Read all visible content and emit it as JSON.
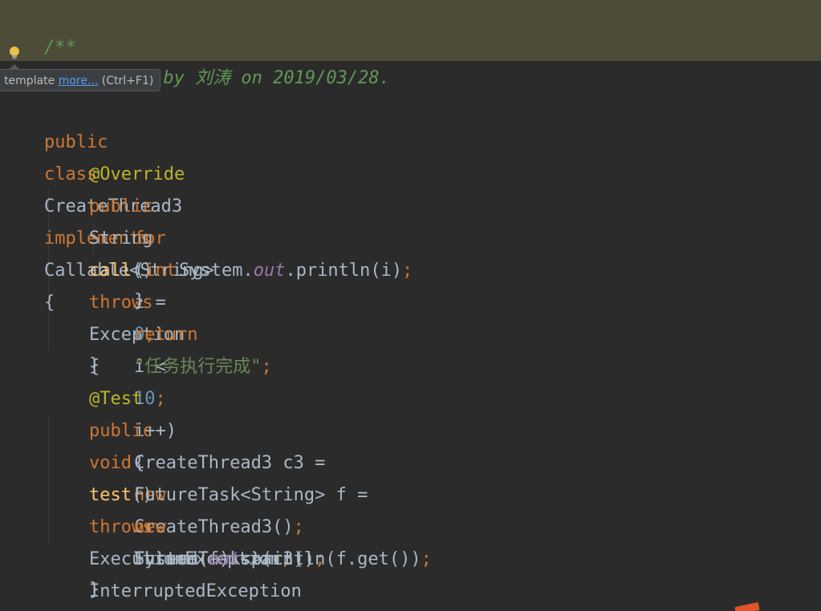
{
  "editor": {
    "colors": {
      "background": "#2b2b2b",
      "doc_band": "#4d4c38",
      "keyword": "#cc7832",
      "annotation": "#bbb529",
      "method": "#ffc66d",
      "number": "#6897bb",
      "string": "#6a8759",
      "static_field": "#9876aa",
      "comment": "#629755",
      "text": "#a9b7c6"
    },
    "doc": {
      "open": "/**",
      "created_line": "* Created by 刘涛 on 2019/03/28."
    },
    "tooltip": {
      "prefix": "e template",
      "link": "more...",
      "shortcut": "(Ctrl+F1)"
    },
    "tokens": {
      "public": "public",
      "class": "class",
      "class_name": "CreateThread3",
      "implements": "implements",
      "callable": "Callable<String>",
      "brace_open": "{",
      "brace_close": "}",
      "override": "@Override",
      "string_type": "String",
      "call": "call",
      "parens": "()",
      "throws": "throws",
      "exception": "Exception",
      "for": "for",
      "paren_open": "(",
      "int": "int",
      "i_assign": "i =",
      "zero": "0",
      "semi": ";",
      "i_lt": "i <",
      "ten": "10",
      "i_inc": "i++)",
      "system": "System.",
      "out": "out",
      "println_i": ".println(i)",
      "return": "return",
      "result_string": "\"任务执行完成\"",
      "test_ann": "@Test",
      "void": "void",
      "test": "test",
      "execution_exception": "ExecutionException",
      "comma": ",",
      "interrupted_exception": "InterruptedException",
      "decl_c3": "CreateThread3 c3 =",
      "new": "new",
      "ctor_c3": "CreateThread3()",
      "decl_f": "FutureTask<String> f =",
      "ctor_ft": "FutureTask<>(c3)",
      "thread_start": "Thread(f).start()",
      "println_get": ".println(f.get())"
    }
  }
}
